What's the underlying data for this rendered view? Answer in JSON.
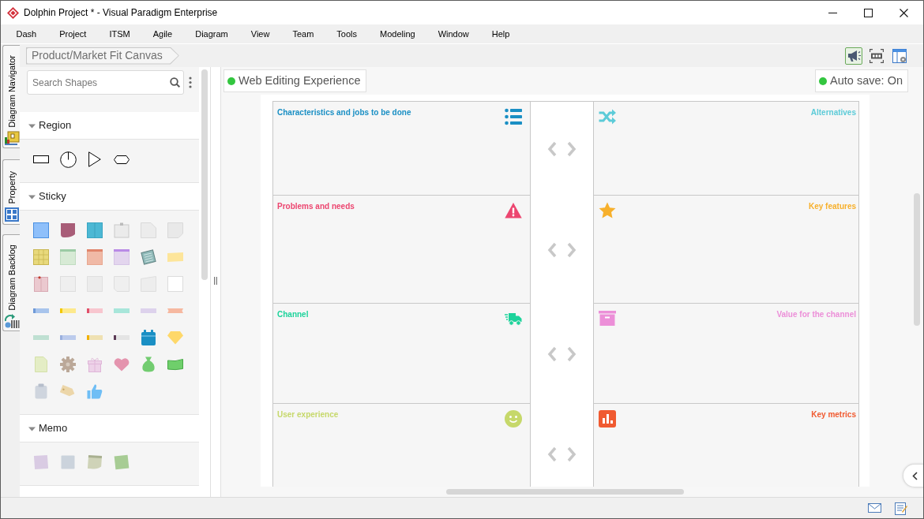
{
  "window": {
    "title": "Dolphin Project * - Visual Paradigm Enterprise"
  },
  "menu": [
    "Dash",
    "Project",
    "ITSM",
    "Agile",
    "Diagram",
    "View",
    "Team",
    "Tools",
    "Modeling",
    "Window",
    "Help"
  ],
  "side_tabs": [
    {
      "label": "Diagram Navigator"
    },
    {
      "label": "Property"
    },
    {
      "label": "Diagram Backlog"
    }
  ],
  "breadcrumb": "Product/Market Fit Canvas",
  "toolbar_buttons": [
    {
      "active": true
    },
    {
      "active": false
    },
    {
      "active": false
    }
  ],
  "palette": {
    "search": {
      "placeholder": "Search Shapes"
    },
    "sections": [
      {
        "title": "Region",
        "expanded": true
      },
      {
        "title": "Sticky",
        "expanded": true
      },
      {
        "title": "Memo",
        "expanded": true
      }
    ]
  },
  "canvas": {
    "mode_badge": "Web Editing Experience",
    "autosave": "Auto save: On",
    "left_blocks": [
      {
        "title": "Characteristics and jobs to be done",
        "color": "#1a8fc4"
      },
      {
        "title": "Problems and needs",
        "color": "#ec4670"
      },
      {
        "title": "Channel",
        "color": "#1dd39b"
      },
      {
        "title": "User experience",
        "color": "#c6d86a"
      }
    ],
    "right_blocks": [
      {
        "title": "Alternatives",
        "color": "#5ccbd8"
      },
      {
        "title": "Key features",
        "color": "#f7b02c"
      },
      {
        "title": "Value for the channel",
        "color": "#ec8fd8"
      },
      {
        "title": "Key metrics",
        "color": "#f05a30"
      }
    ]
  }
}
